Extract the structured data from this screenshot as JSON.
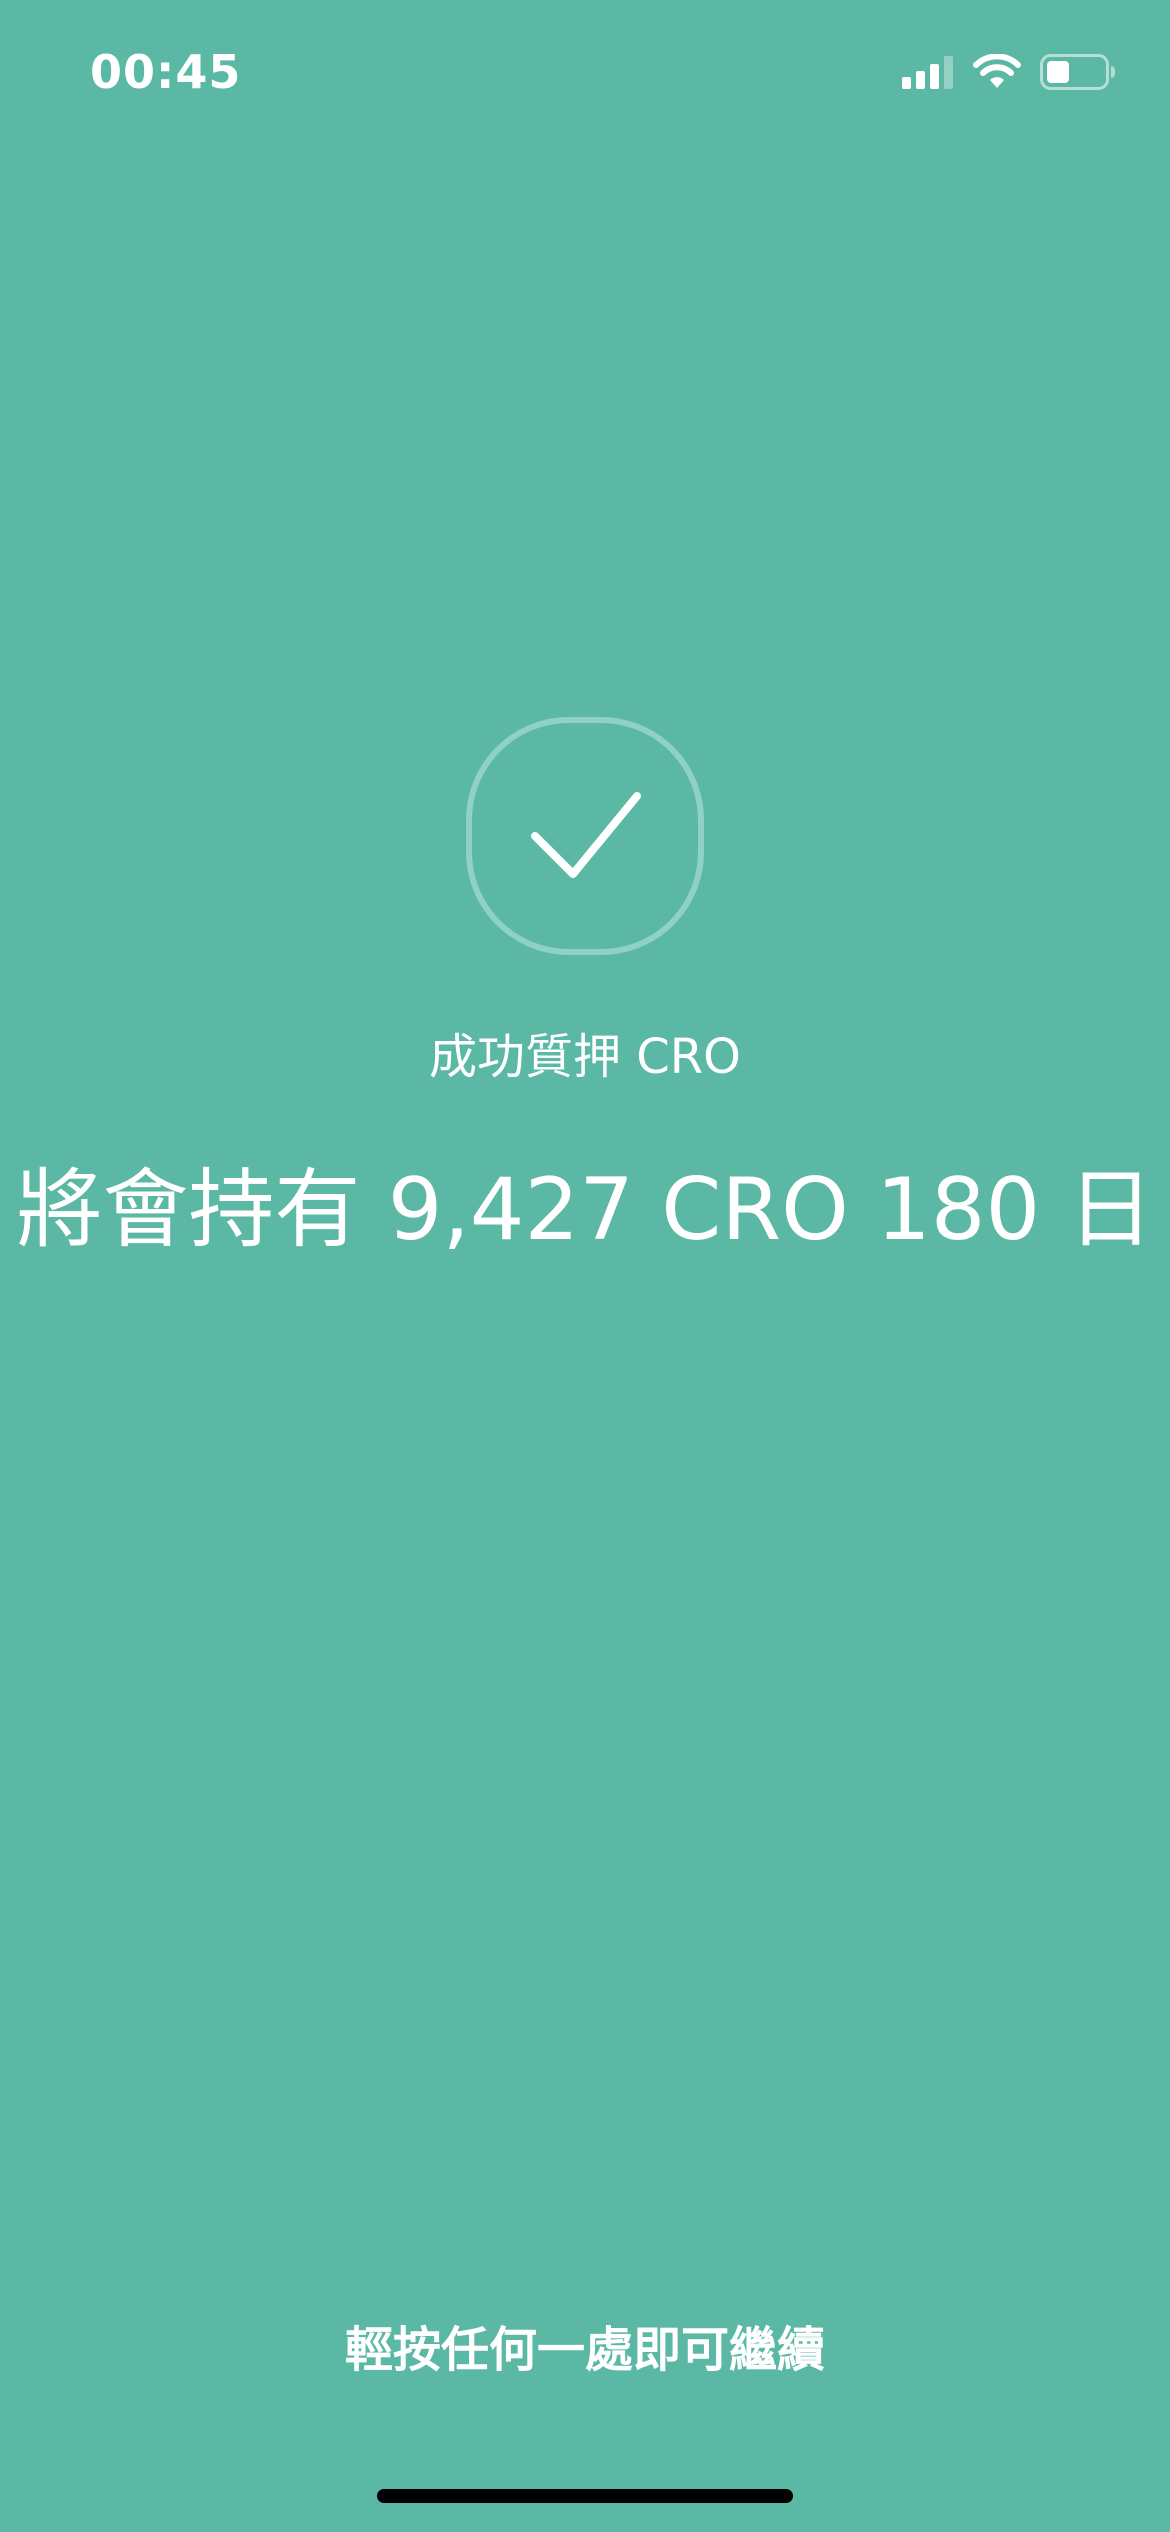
{
  "status_bar": {
    "time": "00:45",
    "signal_icon": "cellular-signal-icon",
    "wifi_icon": "wifi-icon",
    "battery_icon": "battery-icon",
    "battery_level": 0.35
  },
  "confirmation": {
    "icon": "checkmark-icon",
    "subtitle": "成功質押 CRO",
    "headline": "將會持有 9,427 CRO 180 日"
  },
  "footer": {
    "continue_hint": "輕按任何一處即可繼續"
  },
  "colors": {
    "background": "#5bb8a4",
    "text": "#ffffff",
    "badge_border": "#8fd2c3"
  }
}
